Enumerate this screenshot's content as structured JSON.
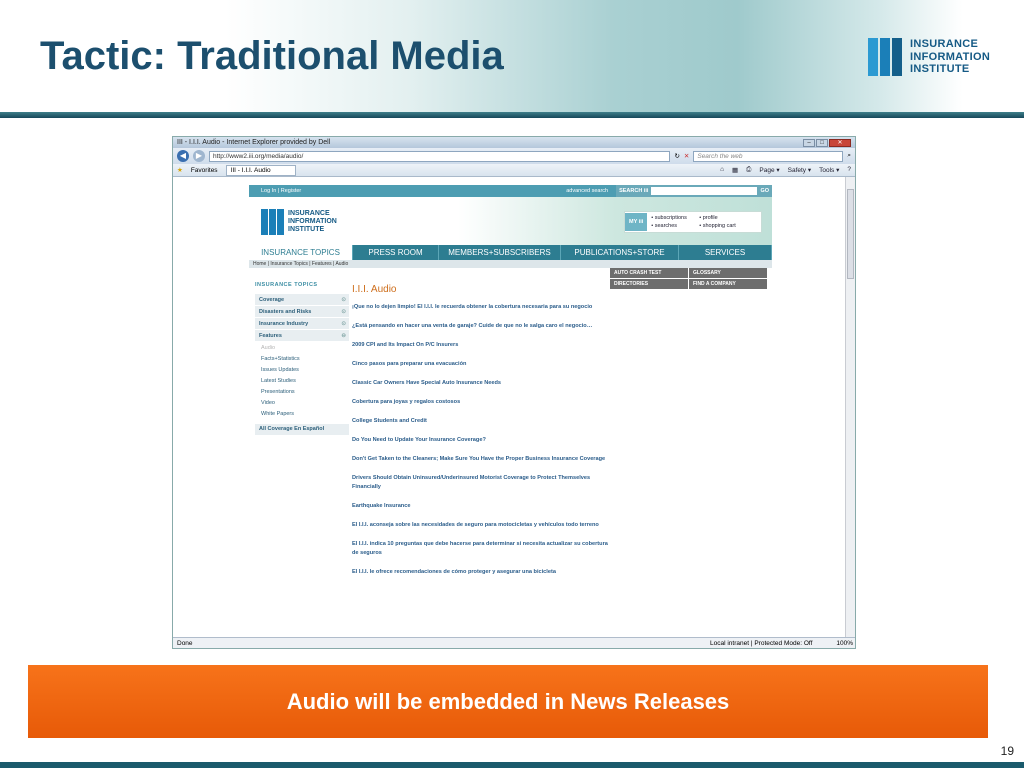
{
  "slide": {
    "title": "Tactic: Traditional Media",
    "logo_lines": [
      "INSURANCE",
      "INFORMATION",
      "INSTITUTE"
    ],
    "callout": "Audio will be embedded in News Releases",
    "page_number": "19",
    "colors": {
      "title": "#1c4f6e",
      "callout": "#f26b12",
      "accent": "#1b7fb8"
    }
  },
  "browser": {
    "window_title": "III - I.I.I. Audio - Internet Explorer provided by Dell",
    "url": "http://www2.iii.org/media/audio/",
    "search_placeholder": "Search the web",
    "favorites": "Favorites",
    "tab_title": "III - I.I.I. Audio",
    "toolbar": [
      "Page ▾",
      "Safety ▾",
      "Tools ▾"
    ],
    "status_left": "Done",
    "status_zone": "Local intranet | Protected Mode: Off",
    "zoom": "100%"
  },
  "site": {
    "top": {
      "login": "Log In  |  Register",
      "advanced": "advanced search",
      "search_label": "SEARCH iii",
      "go": "GO"
    },
    "logo_lines": [
      "INSURANCE",
      "INFORMATION",
      "INSTITUTE"
    ],
    "myiii": {
      "label": "MY iii",
      "links": [
        "• subscriptions",
        "• profile",
        "• searches",
        "• shopping cart"
      ]
    },
    "nav": [
      "INSURANCE TOPICS",
      "PRESS ROOM",
      "MEMBERS+SUBSCRIBERS",
      "PUBLICATIONS+STORE",
      "SERVICES"
    ],
    "breadcrumb": "Home  |  Insurance Topics  |  Features  |  Audio",
    "sidebar": {
      "heading": "INSURANCE TOPICS",
      "sections": [
        "Coverage",
        "Disasters and Risks",
        "Insurance Industry",
        "Features"
      ],
      "sub": [
        "Audio",
        "Facts+Statistics",
        "Issues Updates",
        "Latest Studies",
        "Presentations",
        "Video",
        "White Papers"
      ],
      "espanol": "All Coverage En Español"
    },
    "content": {
      "heading": "I.I.I. Audio",
      "items": [
        "¡Que no lo dejen limpio! El I.I.I. le recuerda obtener la cobertura necesaria para su negocio",
        "¿Está pensando en hacer una venta de garaje? Cuide de que no le salga caro el negocio…",
        "2009 CPI and Its Impact On P/C Insurers",
        "Cinco pasos para preparar una evacuación",
        "Classic Car Owners Have Special Auto Insurance Needs",
        "Cobertura para joyas y regalos costosos",
        "College Students and Credit",
        "Do You Need to Update Your Insurance Coverage?",
        "Don't Get Taken to the Cleaners; Make Sure You Have the Proper Business Insurance Coverage",
        "Drivers Should Obtain Uninsured/Underinsured Motorist Coverage to Protect Themselves Financially",
        "Earthquake Insurance",
        "El I.I.I. aconseja sobre las necesidades de seguro para motocicletas y vehículos todo terreno",
        "El I.I.I. indica 10 preguntas que debe hacerse para determinar si necesita actualizar su cobertura de seguros",
        "El I.I.I. le ofrece recomendaciones de cómo proteger y asegurar una bicicleta"
      ]
    },
    "quicklinks": [
      "AUTO CRASH TEST",
      "GLOSSARY",
      "DIRECTORIES",
      "FIND A COMPANY"
    ]
  }
}
